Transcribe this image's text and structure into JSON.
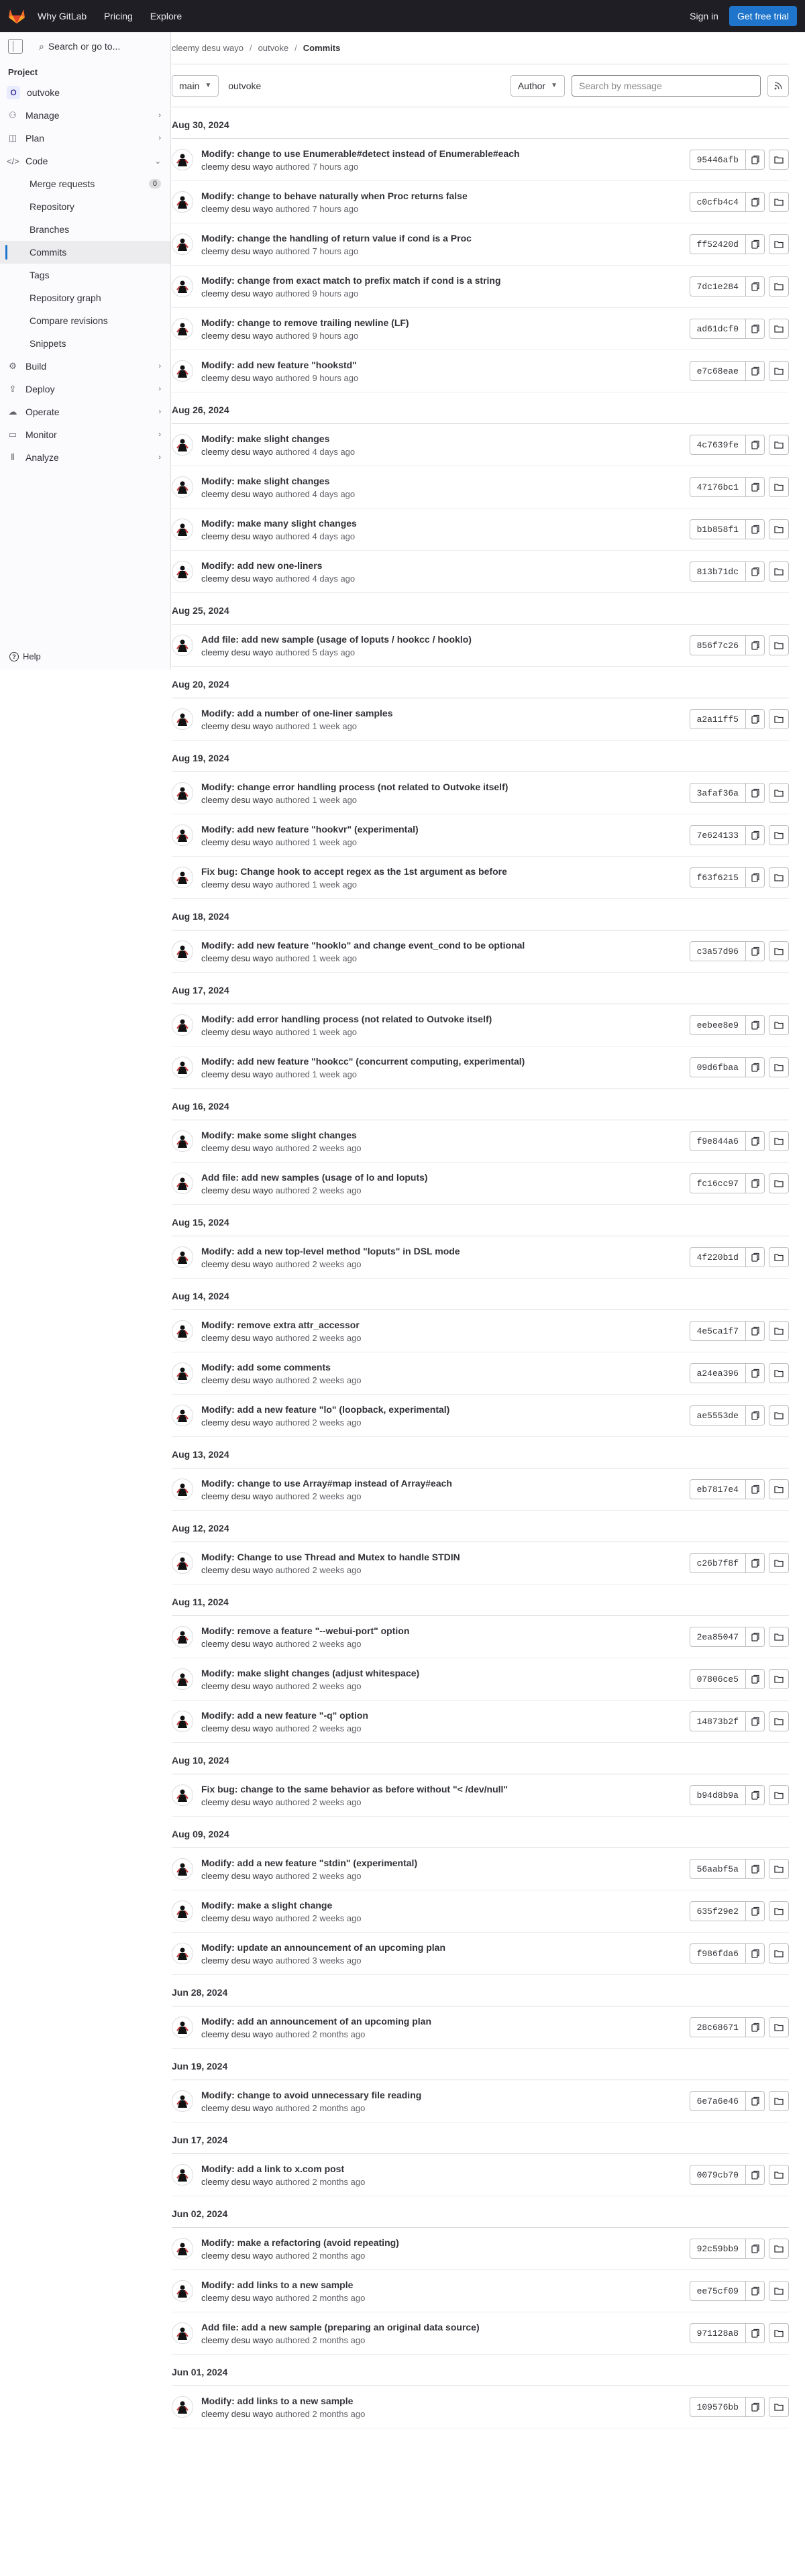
{
  "topbar": {
    "nav": [
      "Why GitLab",
      "Pricing",
      "Explore"
    ],
    "signin": "Sign in",
    "trial": "Get free trial"
  },
  "sidebar": {
    "search": "Search or go to...",
    "section": "Project",
    "project": {
      "initial": "O",
      "name": "outvoke"
    },
    "items_top": [
      {
        "label": "Manage",
        "icon": "users-icon"
      },
      {
        "label": "Plan",
        "icon": "plan-icon"
      },
      {
        "label": "Code",
        "icon": "code-icon"
      }
    ],
    "code_sub": [
      {
        "label": "Merge requests",
        "badge": "0"
      },
      {
        "label": "Repository"
      },
      {
        "label": "Branches"
      },
      {
        "label": "Commits",
        "active": true
      },
      {
        "label": "Tags"
      },
      {
        "label": "Repository graph"
      },
      {
        "label": "Compare revisions"
      },
      {
        "label": "Snippets"
      }
    ],
    "items_bottom": [
      {
        "label": "Build",
        "icon": "rocket-icon"
      },
      {
        "label": "Deploy",
        "icon": "deploy-icon"
      },
      {
        "label": "Operate",
        "icon": "cloud-icon"
      },
      {
        "label": "Monitor",
        "icon": "monitor-icon"
      },
      {
        "label": "Analyze",
        "icon": "chart-icon"
      }
    ],
    "help": "Help"
  },
  "breadcrumb": [
    "cleemy desu wayo",
    "outvoke",
    "Commits"
  ],
  "filter": {
    "branch": "main",
    "path": "outvoke",
    "author": "Author",
    "search_placeholder": "Search by message"
  },
  "days": [
    {
      "date": "Aug 30, 2024",
      "commits": [
        {
          "title": "Modify: change to use Enumerable#detect instead of Enumerable#each",
          "author": "cleemy desu wayo",
          "verb": "authored",
          "time": "7 hours ago",
          "sha": "95446afb"
        },
        {
          "title": "Modify: change to behave naturally when Proc returns false",
          "author": "cleemy desu wayo",
          "verb": "authored",
          "time": "7 hours ago",
          "sha": "c0cfb4c4"
        },
        {
          "title": "Modify: change the handling of return value if cond is a Proc",
          "author": "cleemy desu wayo",
          "verb": "authored",
          "time": "7 hours ago",
          "sha": "ff52420d"
        },
        {
          "title": "Modify: change from exact match to prefix match if cond is a string",
          "author": "cleemy desu wayo",
          "verb": "authored",
          "time": "9 hours ago",
          "sha": "7dc1e284"
        },
        {
          "title": "Modify: change to remove trailing newline (LF)",
          "author": "cleemy desu wayo",
          "verb": "authored",
          "time": "9 hours ago",
          "sha": "ad61dcf0"
        },
        {
          "title": "Modify: add new feature \"hookstd\"",
          "author": "cleemy desu wayo",
          "verb": "authored",
          "time": "9 hours ago",
          "sha": "e7c68eae"
        }
      ]
    },
    {
      "date": "Aug 26, 2024",
      "commits": [
        {
          "title": "Modify: make slight changes",
          "author": "cleemy desu wayo",
          "verb": "authored",
          "time": "4 days ago",
          "sha": "4c7639fe"
        },
        {
          "title": "Modify: make slight changes",
          "author": "cleemy desu wayo",
          "verb": "authored",
          "time": "4 days ago",
          "sha": "47176bc1"
        },
        {
          "title": "Modify: make many slight changes",
          "author": "cleemy desu wayo",
          "verb": "authored",
          "time": "4 days ago",
          "sha": "b1b858f1"
        },
        {
          "title": "Modify: add new one-liners",
          "author": "cleemy desu wayo",
          "verb": "authored",
          "time": "4 days ago",
          "sha": "813b71dc"
        }
      ]
    },
    {
      "date": "Aug 25, 2024",
      "commits": [
        {
          "title": "Add file: add new sample (usage of loputs / hookcc / hooklo)",
          "author": "cleemy desu wayo",
          "verb": "authored",
          "time": "5 days ago",
          "sha": "856f7c26"
        }
      ]
    },
    {
      "date": "Aug 20, 2024",
      "commits": [
        {
          "title": "Modify: add a number of one-liner samples",
          "author": "cleemy desu wayo",
          "verb": "authored",
          "time": "1 week ago",
          "sha": "a2a11ff5"
        }
      ]
    },
    {
      "date": "Aug 19, 2024",
      "commits": [
        {
          "title": "Modify: change error handling process (not related to Outvoke itself)",
          "author": "cleemy desu wayo",
          "verb": "authored",
          "time": "1 week ago",
          "sha": "3afaf36a"
        },
        {
          "title": "Modify: add new feature \"hookvr\" (experimental)",
          "author": "cleemy desu wayo",
          "verb": "authored",
          "time": "1 week ago",
          "sha": "7e624133"
        },
        {
          "title": "Fix bug: Change hook to accept regex as the 1st argument as before",
          "author": "cleemy desu wayo",
          "verb": "authored",
          "time": "1 week ago",
          "sha": "f63f6215"
        }
      ]
    },
    {
      "date": "Aug 18, 2024",
      "commits": [
        {
          "title": "Modify: add new feature \"hooklo\" and change event_cond to be optional",
          "author": "cleemy desu wayo",
          "verb": "authored",
          "time": "1 week ago",
          "sha": "c3a57d96"
        }
      ]
    },
    {
      "date": "Aug 17, 2024",
      "commits": [
        {
          "title": "Modify: add error handling process (not related to Outvoke itself)",
          "author": "cleemy desu wayo",
          "verb": "authored",
          "time": "1 week ago",
          "sha": "eebee8e9"
        },
        {
          "title": "Modify: add new feature \"hookcc\" (concurrent computing, experimental)",
          "author": "cleemy desu wayo",
          "verb": "authored",
          "time": "1 week ago",
          "sha": "09d6fbaa"
        }
      ]
    },
    {
      "date": "Aug 16, 2024",
      "commits": [
        {
          "title": "Modify: make some slight changes",
          "author": "cleemy desu wayo",
          "verb": "authored",
          "time": "2 weeks ago",
          "sha": "f9e844a6"
        },
        {
          "title": "Add file: add new samples (usage of lo and loputs)",
          "author": "cleemy desu wayo",
          "verb": "authored",
          "time": "2 weeks ago",
          "sha": "fc16cc97"
        }
      ]
    },
    {
      "date": "Aug 15, 2024",
      "commits": [
        {
          "title": "Modify: add a new top-level method \"loputs\" in DSL mode",
          "author": "cleemy desu wayo",
          "verb": "authored",
          "time": "2 weeks ago",
          "sha": "4f220b1d"
        }
      ]
    },
    {
      "date": "Aug 14, 2024",
      "commits": [
        {
          "title": "Modify: remove extra attr_accessor",
          "author": "cleemy desu wayo",
          "verb": "authored",
          "time": "2 weeks ago",
          "sha": "4e5ca1f7"
        },
        {
          "title": "Modify: add some comments",
          "author": "cleemy desu wayo",
          "verb": "authored",
          "time": "2 weeks ago",
          "sha": "a24ea396"
        },
        {
          "title": "Modify: add a new feature \"lo\" (loopback, experimental)",
          "author": "cleemy desu wayo",
          "verb": "authored",
          "time": "2 weeks ago",
          "sha": "ae5553de"
        }
      ]
    },
    {
      "date": "Aug 13, 2024",
      "commits": [
        {
          "title": "Modify: change to use Array#map instead of Array#each",
          "author": "cleemy desu wayo",
          "verb": "authored",
          "time": "2 weeks ago",
          "sha": "eb7817e4"
        }
      ]
    },
    {
      "date": "Aug 12, 2024",
      "commits": [
        {
          "title": "Modify: Change to use Thread and Mutex to handle STDIN",
          "author": "cleemy desu wayo",
          "verb": "authored",
          "time": "2 weeks ago",
          "sha": "c26b7f8f"
        }
      ]
    },
    {
      "date": "Aug 11, 2024",
      "commits": [
        {
          "title": "Modify: remove a feature \"--webui-port\" option",
          "author": "cleemy desu wayo",
          "verb": "authored",
          "time": "2 weeks ago",
          "sha": "2ea85047"
        },
        {
          "title": "Modify: make slight changes (adjust whitespace)",
          "author": "cleemy desu wayo",
          "verb": "authored",
          "time": "2 weeks ago",
          "sha": "07806ce5"
        },
        {
          "title": "Modify: add a new feature \"-q\" option",
          "author": "cleemy desu wayo",
          "verb": "authored",
          "time": "2 weeks ago",
          "sha": "14873b2f"
        }
      ]
    },
    {
      "date": "Aug 10, 2024",
      "commits": [
        {
          "title": "Fix bug: change to the same behavior as before without \"< /dev/null\"",
          "author": "cleemy desu wayo",
          "verb": "authored",
          "time": "2 weeks ago",
          "sha": "b94d8b9a"
        }
      ]
    },
    {
      "date": "Aug 09, 2024",
      "commits": [
        {
          "title": "Modify: add a new feature \"stdin\" (experimental)",
          "author": "cleemy desu wayo",
          "verb": "authored",
          "time": "2 weeks ago",
          "sha": "56aabf5a"
        },
        {
          "title": "Modify: make a slight change",
          "author": "cleemy desu wayo",
          "verb": "authored",
          "time": "2 weeks ago",
          "sha": "635f29e2"
        },
        {
          "title": "Modify: update an announcement of an upcoming plan",
          "author": "cleemy desu wayo",
          "verb": "authored",
          "time": "3 weeks ago",
          "sha": "f986fda6"
        }
      ]
    },
    {
      "date": "Jun 28, 2024",
      "commits": [
        {
          "title": "Modify: add an announcement of an upcoming plan",
          "author": "cleemy desu wayo",
          "verb": "authored",
          "time": "2 months ago",
          "sha": "28c68671"
        }
      ]
    },
    {
      "date": "Jun 19, 2024",
      "commits": [
        {
          "title": "Modify: change to avoid unnecessary file reading",
          "author": "cleemy desu wayo",
          "verb": "authored",
          "time": "2 months ago",
          "sha": "6e7a6e46"
        }
      ]
    },
    {
      "date": "Jun 17, 2024",
      "commits": [
        {
          "title": "Modify: add a link to x.com post",
          "author": "cleemy desu wayo",
          "verb": "authored",
          "time": "2 months ago",
          "sha": "0079cb70"
        }
      ]
    },
    {
      "date": "Jun 02, 2024",
      "commits": [
        {
          "title": "Modify: make a refactoring (avoid repeating)",
          "author": "cleemy desu wayo",
          "verb": "authored",
          "time": "2 months ago",
          "sha": "92c59bb9"
        },
        {
          "title": "Modify: add links to a new sample",
          "author": "cleemy desu wayo",
          "verb": "authored",
          "time": "2 months ago",
          "sha": "ee75cf09"
        },
        {
          "title": "Add file: add a new sample (preparing an original data source)",
          "author": "cleemy desu wayo",
          "verb": "authored",
          "time": "2 months ago",
          "sha": "971128a8"
        }
      ]
    },
    {
      "date": "Jun 01, 2024",
      "commits": [
        {
          "title": "Modify: add links to a new sample",
          "author": "cleemy desu wayo",
          "verb": "authored",
          "time": "2 months ago",
          "sha": "109576bb"
        }
      ]
    }
  ]
}
